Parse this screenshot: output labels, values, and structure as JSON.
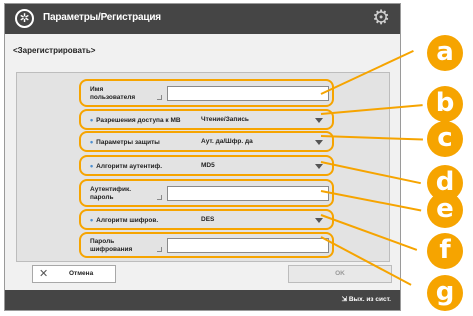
{
  "title_bar": {
    "title": "Параметры/Регистрация"
  },
  "subtitle": "<Зарегистрировать>",
  "form": {
    "user_name_label": "Имя\nпользователя",
    "access_label": "Разрешения доступа к МВ",
    "access_value": "Чтение/Запись",
    "security_label": "Параметры защиты",
    "security_value": "Аут. да/Шфр. да",
    "auth_method_label": "Алгоритм аутентиф.",
    "auth_method_value": "MD5",
    "auth_password_label": "Аутентифик.\nпароль",
    "encryption_label": "Алгоритм шифров.",
    "encryption_value": "DES",
    "encryption_password_label": "Пароль\nшифрования"
  },
  "buttons": {
    "cancel_label": "Отмена",
    "ok_label": "OK"
  },
  "bottom_bar": {
    "status_label": "Вых. из сист."
  },
  "callouts": [
    "a",
    "b",
    "c",
    "d",
    "e",
    "f",
    "g"
  ],
  "colors": {
    "accent": "#f6a400",
    "titlebar": "#454545",
    "bullet": "#4d8fd0"
  },
  "icons": {
    "title": "settings-register-icon",
    "gear": "gear-icon",
    "dropdown": "triangle-down-icon",
    "cancel": "close-icon",
    "logout": "logout-icon"
  }
}
